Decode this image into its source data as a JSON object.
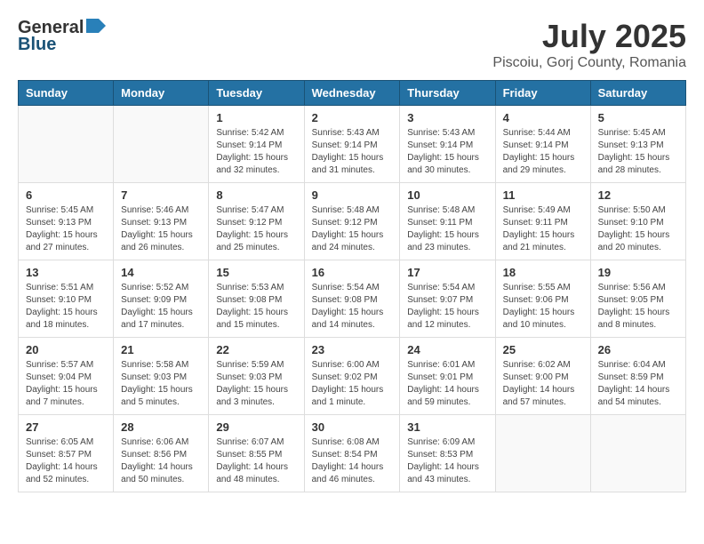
{
  "header": {
    "logo_general": "General",
    "logo_blue": "Blue",
    "title": "July 2025",
    "subtitle": "Piscoiu, Gorj County, Romania"
  },
  "days_of_week": [
    "Sunday",
    "Monday",
    "Tuesday",
    "Wednesday",
    "Thursday",
    "Friday",
    "Saturday"
  ],
  "weeks": [
    [
      {
        "day": "",
        "info": ""
      },
      {
        "day": "",
        "info": ""
      },
      {
        "day": "1",
        "info": "Sunrise: 5:42 AM\nSunset: 9:14 PM\nDaylight: 15 hours\nand 32 minutes."
      },
      {
        "day": "2",
        "info": "Sunrise: 5:43 AM\nSunset: 9:14 PM\nDaylight: 15 hours\nand 31 minutes."
      },
      {
        "day": "3",
        "info": "Sunrise: 5:43 AM\nSunset: 9:14 PM\nDaylight: 15 hours\nand 30 minutes."
      },
      {
        "day": "4",
        "info": "Sunrise: 5:44 AM\nSunset: 9:14 PM\nDaylight: 15 hours\nand 29 minutes."
      },
      {
        "day": "5",
        "info": "Sunrise: 5:45 AM\nSunset: 9:13 PM\nDaylight: 15 hours\nand 28 minutes."
      }
    ],
    [
      {
        "day": "6",
        "info": "Sunrise: 5:45 AM\nSunset: 9:13 PM\nDaylight: 15 hours\nand 27 minutes."
      },
      {
        "day": "7",
        "info": "Sunrise: 5:46 AM\nSunset: 9:13 PM\nDaylight: 15 hours\nand 26 minutes."
      },
      {
        "day": "8",
        "info": "Sunrise: 5:47 AM\nSunset: 9:12 PM\nDaylight: 15 hours\nand 25 minutes."
      },
      {
        "day": "9",
        "info": "Sunrise: 5:48 AM\nSunset: 9:12 PM\nDaylight: 15 hours\nand 24 minutes."
      },
      {
        "day": "10",
        "info": "Sunrise: 5:48 AM\nSunset: 9:11 PM\nDaylight: 15 hours\nand 23 minutes."
      },
      {
        "day": "11",
        "info": "Sunrise: 5:49 AM\nSunset: 9:11 PM\nDaylight: 15 hours\nand 21 minutes."
      },
      {
        "day": "12",
        "info": "Sunrise: 5:50 AM\nSunset: 9:10 PM\nDaylight: 15 hours\nand 20 minutes."
      }
    ],
    [
      {
        "day": "13",
        "info": "Sunrise: 5:51 AM\nSunset: 9:10 PM\nDaylight: 15 hours\nand 18 minutes."
      },
      {
        "day": "14",
        "info": "Sunrise: 5:52 AM\nSunset: 9:09 PM\nDaylight: 15 hours\nand 17 minutes."
      },
      {
        "day": "15",
        "info": "Sunrise: 5:53 AM\nSunset: 9:08 PM\nDaylight: 15 hours\nand 15 minutes."
      },
      {
        "day": "16",
        "info": "Sunrise: 5:54 AM\nSunset: 9:08 PM\nDaylight: 15 hours\nand 14 minutes."
      },
      {
        "day": "17",
        "info": "Sunrise: 5:54 AM\nSunset: 9:07 PM\nDaylight: 15 hours\nand 12 minutes."
      },
      {
        "day": "18",
        "info": "Sunrise: 5:55 AM\nSunset: 9:06 PM\nDaylight: 15 hours\nand 10 minutes."
      },
      {
        "day": "19",
        "info": "Sunrise: 5:56 AM\nSunset: 9:05 PM\nDaylight: 15 hours\nand 8 minutes."
      }
    ],
    [
      {
        "day": "20",
        "info": "Sunrise: 5:57 AM\nSunset: 9:04 PM\nDaylight: 15 hours\nand 7 minutes."
      },
      {
        "day": "21",
        "info": "Sunrise: 5:58 AM\nSunset: 9:03 PM\nDaylight: 15 hours\nand 5 minutes."
      },
      {
        "day": "22",
        "info": "Sunrise: 5:59 AM\nSunset: 9:03 PM\nDaylight: 15 hours\nand 3 minutes."
      },
      {
        "day": "23",
        "info": "Sunrise: 6:00 AM\nSunset: 9:02 PM\nDaylight: 15 hours\nand 1 minute."
      },
      {
        "day": "24",
        "info": "Sunrise: 6:01 AM\nSunset: 9:01 PM\nDaylight: 14 hours\nand 59 minutes."
      },
      {
        "day": "25",
        "info": "Sunrise: 6:02 AM\nSunset: 9:00 PM\nDaylight: 14 hours\nand 57 minutes."
      },
      {
        "day": "26",
        "info": "Sunrise: 6:04 AM\nSunset: 8:59 PM\nDaylight: 14 hours\nand 54 minutes."
      }
    ],
    [
      {
        "day": "27",
        "info": "Sunrise: 6:05 AM\nSunset: 8:57 PM\nDaylight: 14 hours\nand 52 minutes."
      },
      {
        "day": "28",
        "info": "Sunrise: 6:06 AM\nSunset: 8:56 PM\nDaylight: 14 hours\nand 50 minutes."
      },
      {
        "day": "29",
        "info": "Sunrise: 6:07 AM\nSunset: 8:55 PM\nDaylight: 14 hours\nand 48 minutes."
      },
      {
        "day": "30",
        "info": "Sunrise: 6:08 AM\nSunset: 8:54 PM\nDaylight: 14 hours\nand 46 minutes."
      },
      {
        "day": "31",
        "info": "Sunrise: 6:09 AM\nSunset: 8:53 PM\nDaylight: 14 hours\nand 43 minutes."
      },
      {
        "day": "",
        "info": ""
      },
      {
        "day": "",
        "info": ""
      }
    ]
  ]
}
